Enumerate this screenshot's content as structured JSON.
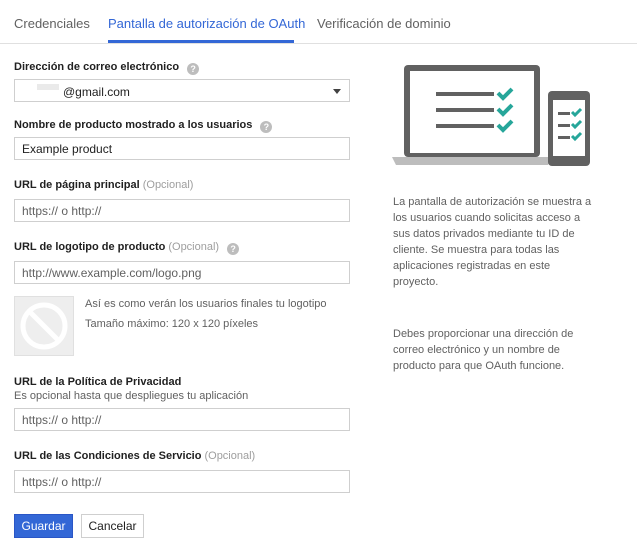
{
  "tabs": [
    {
      "label": "Credenciales",
      "active": false
    },
    {
      "label": "Pantalla de autorización de OAuth",
      "active": true
    },
    {
      "label": "Verificación de dominio",
      "active": false
    }
  ],
  "form": {
    "email": {
      "label": "Dirección de correo electrónico",
      "value": "@gmail.com"
    },
    "product_name": {
      "label": "Nombre de producto mostrado a los usuarios",
      "value": "Example product"
    },
    "homepage_url": {
      "label": "URL de página principal",
      "optional": "(Opcional)",
      "placeholder": "https:// o http://"
    },
    "logo_url": {
      "label": "URL de logotipo de producto",
      "optional": "(Opcional)",
      "placeholder": "http://www.example.com/logo.png"
    },
    "logo_preview": {
      "caption": "Así es como verán los usuarios finales tu logotipo",
      "max_size": "Tamaño máximo: 120 x 120 píxeles"
    },
    "privacy_url": {
      "label": "URL de la Política de Privacidad",
      "hint": "Es opcional hasta que despliegues tu aplicación",
      "placeholder": "https:// o http://"
    },
    "tos_url": {
      "label": "URL de las Condiciones de Servicio",
      "optional": "(Opcional)",
      "placeholder": "https:// o http://"
    }
  },
  "buttons": {
    "save": "Guardar",
    "cancel": "Cancelar"
  },
  "sidebar": {
    "paragraph1": "La pantalla de autorización se muestra a los usuarios cuando solicitas acceso a sus datos privados mediante tu ID de cliente. Se muestra para todas las aplicaciones registradas en este proyecto.",
    "paragraph2": "Debes proporcionar una dirección de correo electrónico y un nombre de producto para que OAuth funcione."
  },
  "colors": {
    "accent": "#3367d6",
    "check": "#26a69a",
    "device": "#616161"
  },
  "icons": [
    "help-icon",
    "dropdown-caret-icon",
    "no-logo-icon",
    "laptop-illustration",
    "phone-illustration",
    "checkmark-icon"
  ]
}
